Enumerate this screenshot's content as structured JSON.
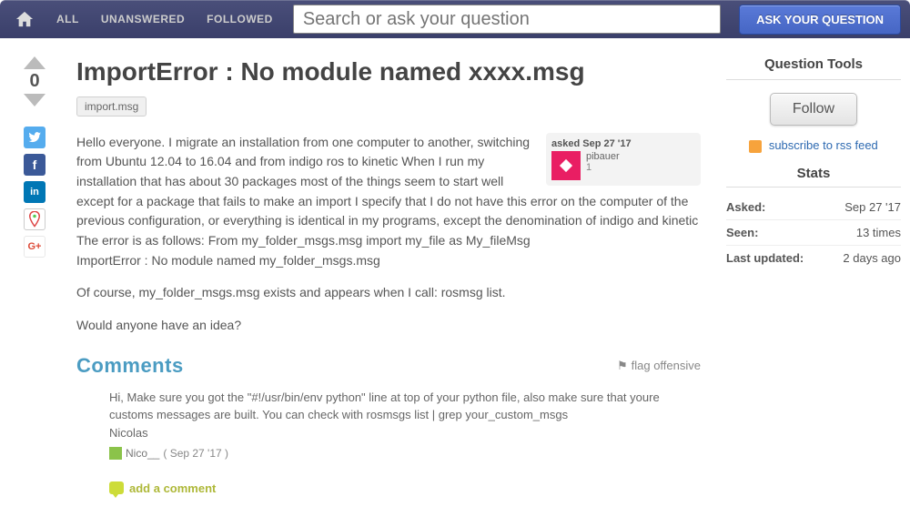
{
  "nav": {
    "all": "ALL",
    "unanswered": "UNANSWERED",
    "followed": "FOLLOWED",
    "search_placeholder": "Search or ask your question",
    "ask_button": "ASK YOUR QUESTION"
  },
  "vote": {
    "count": "0"
  },
  "question": {
    "title": "ImportError : No module named xxxx.msg",
    "tag": "import.msg",
    "body_p1": "Hello everyone. I migrate an installation from one computer to another, switching from Ubuntu 12.04 to 16.04 and from indigo ros to kinetic When I run my installation that has about 30 packages most of the things seem to start well except for a package that fails to make an import I specify that I do not have this error on the computer of the previous configuration, or everything is identical in my programs, except the denomination of indigo and kinetic The error is as follows: From my_folder_msgs.msg import my_file as My_fileMsg",
    "body_p1b": "ImportError : No module named my_folder_msgs.msg",
    "body_p2": "Of course, my_folder_msgs.msg exists and appears when I call: rosmsg list.",
    "body_p3": "Would anyone have an idea?"
  },
  "author": {
    "asked_label": "asked Sep 27 '17",
    "name": "pibauer",
    "karma": "1"
  },
  "comments": {
    "title": "Comments",
    "flag": "flag offensive",
    "items": [
      {
        "text": "Hi, Make sure you got the \"#!/usr/bin/env python\" line at top of your python file, also make sure that youre customs messages are built. You can check with rosmsgs list | grep your_custom_msgs",
        "signature": "Nicolas",
        "user": "Nico__",
        "date": "( Sep 27 '17 )"
      }
    ],
    "add": "add a comment"
  },
  "sidebar": {
    "tools_title": "Question Tools",
    "follow": "Follow",
    "rss": "subscribe to rss feed",
    "stats_title": "Stats",
    "stats": {
      "asked_label": "Asked:",
      "asked_val": "Sep 27 '17",
      "seen_label": "Seen:",
      "seen_val": "13 times",
      "updated_label": "Last updated:",
      "updated_val": "2 days ago"
    }
  }
}
